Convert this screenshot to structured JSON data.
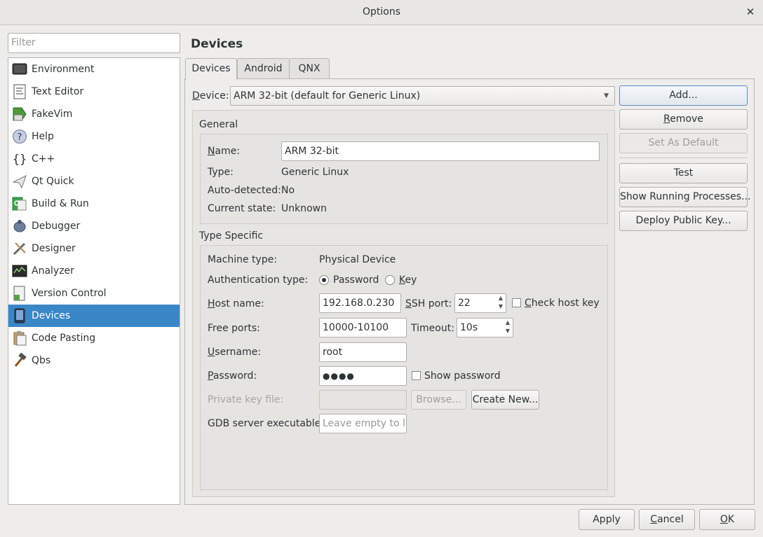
{
  "window": {
    "title": "Options",
    "close_symbol": "✕"
  },
  "filter": {
    "placeholder": "Filter"
  },
  "sidebar": {
    "items": [
      {
        "label": "Environment",
        "icon": "monitor-icon"
      },
      {
        "label": "Text Editor",
        "icon": "text-editor-icon"
      },
      {
        "label": "FakeVim",
        "icon": "fakevim-icon"
      },
      {
        "label": "Help",
        "icon": "help-icon"
      },
      {
        "label": "C++",
        "icon": "cpp-braces-icon"
      },
      {
        "label": "Qt Quick",
        "icon": "qt-quick-icon"
      },
      {
        "label": "Build & Run",
        "icon": "build-run-icon"
      },
      {
        "label": "Debugger",
        "icon": "debugger-bug-icon"
      },
      {
        "label": "Designer",
        "icon": "designer-icon"
      },
      {
        "label": "Analyzer",
        "icon": "analyzer-icon"
      },
      {
        "label": "Version Control",
        "icon": "version-control-icon"
      },
      {
        "label": "Devices",
        "icon": "device-icon"
      },
      {
        "label": "Code Pasting",
        "icon": "code-pasting-icon"
      },
      {
        "label": "Qbs",
        "icon": "qbs-hammer-icon"
      }
    ],
    "selected": "Devices"
  },
  "page": {
    "title": "Devices"
  },
  "tabs": [
    "Devices",
    "Android",
    "QNX"
  ],
  "device_select": {
    "label": "Device:",
    "value": "ARM 32-bit (default for Generic Linux)"
  },
  "general": {
    "title": "General",
    "name_label": "Name:",
    "name_value": "ARM 32-bit",
    "type_label": "Type:",
    "type_value": "Generic Linux",
    "auto_label": "Auto-detected:",
    "auto_value": "No",
    "state_label": "Current state:",
    "state_value": "Unknown"
  },
  "type_specific": {
    "title": "Type Specific",
    "machine_label": "Machine type:",
    "machine_value": "Physical Device",
    "auth_label": "Authentication type:",
    "auth_password": "Password",
    "auth_key": "Key",
    "auth_selected": "Password",
    "host_label": "Host name:",
    "host_value": "192.168.0.230",
    "ssh_label": "SSH port:",
    "ssh_value": "22",
    "check_host_key": "Check host key",
    "free_ports_label": "Free ports:",
    "free_ports_value": "10000-10100",
    "timeout_label": "Timeout:",
    "timeout_value": "10s",
    "username_label": "Username:",
    "username_value": "root",
    "password_label": "Password:",
    "password_value": "●●●●",
    "show_password": "Show password",
    "private_key_label": "Private key file:",
    "browse_label": "Browse...",
    "create_new_label": "Create New...",
    "gdb_label": "GDB server executable:",
    "gdb_placeholder": "Leave empty to l..."
  },
  "actions": {
    "add": "Add...",
    "remove": "Remove",
    "set_default": "Set As Default",
    "test": "Test",
    "show_processes": "Show Running Processes...",
    "deploy_key": "Deploy Public Key..."
  },
  "footer": {
    "apply": "Apply",
    "cancel": "Cancel",
    "ok": "OK"
  }
}
